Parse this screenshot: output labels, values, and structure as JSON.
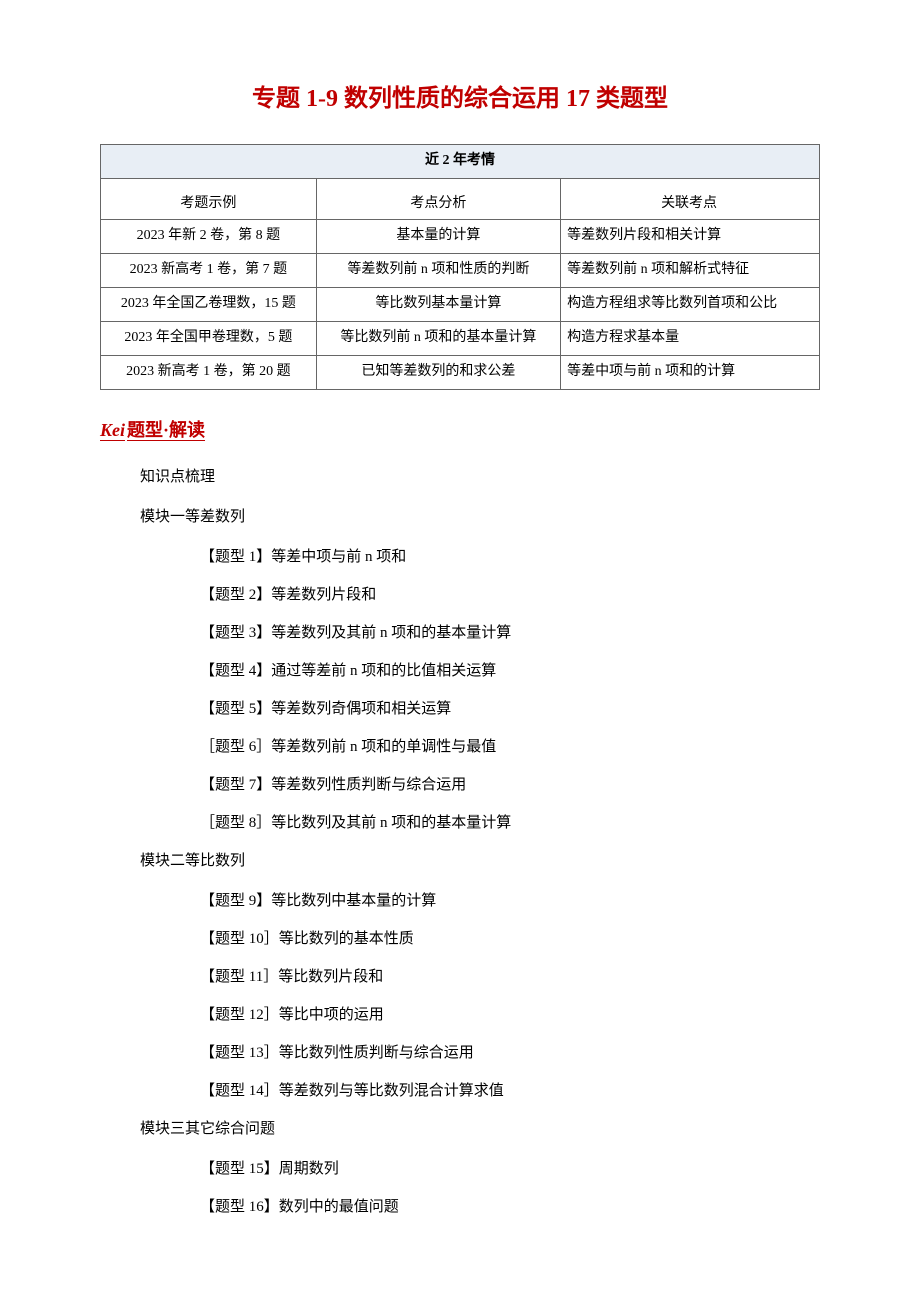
{
  "title": "专题 1-9 数列性质的综合运用 17 类题型",
  "table": {
    "caption": "近 2 年考情",
    "headers": {
      "c1": "考题示例",
      "c2": "考点分析",
      "c3": "关联考点"
    },
    "rows": [
      {
        "c1": "2023 年新 2 卷，第 8 题",
        "c2": "基本量的计算",
        "c3": "等差数列片段和相关计算"
      },
      {
        "c1": "2023 新高考 1 卷，第 7 题",
        "c2": "等差数列前 n 项和性质的判断",
        "c3": "等差数列前 n 项和解析式特征"
      },
      {
        "c1": "2023 年全国乙卷理数，15 题",
        "c2": "等比数列基本量计算",
        "c3": "构造方程组求等比数列首项和公比"
      },
      {
        "c1": "2023 年全国甲卷理数，5 题",
        "c2": "等比数列前 n 项和的基本量计算",
        "c3": "构造方程求基本量"
      },
      {
        "c1": "2023 新高考 1 卷，第 20 题",
        "c2": "已知等差数列的和求公差",
        "c3": "等差中项与前 n 项和的计算"
      }
    ]
  },
  "section_marker": {
    "prefix": "Kei",
    "label": "题型·解读"
  },
  "outline": {
    "kpoint": "知识点梳理",
    "modules": [
      {
        "name": "模块一等差数列",
        "items": [
          "【题型 1】等差中项与前 n 项和",
          "【题型 2】等差数列片段和",
          "【题型 3】等差数列及其前 n 项和的基本量计算",
          "【题型 4】通过等差前 n 项和的比值相关运算",
          "【题型 5】等差数列奇偶项和相关运算",
          "［题型 6］等差数列前 n 项和的单调性与最值",
          "【题型 7】等差数列性质判断与综合运用",
          "［题型 8］等比数列及其前 n 项和的基本量计算"
        ]
      },
      {
        "name": "模块二等比数列",
        "items": [
          "【题型 9】等比数列中基本量的计算",
          "【题型 10］等比数列的基本性质",
          "【题型 11］等比数列片段和",
          "【题型 12］等比中项的运用",
          "【题型 13］等比数列性质判断与综合运用",
          "【题型 14］等差数列与等比数列混合计算求值"
        ]
      },
      {
        "name": "模块三其它综合问题",
        "items": [
          "【题型 15】周期数列",
          "【题型 16】数列中的最值问题"
        ]
      }
    ]
  }
}
